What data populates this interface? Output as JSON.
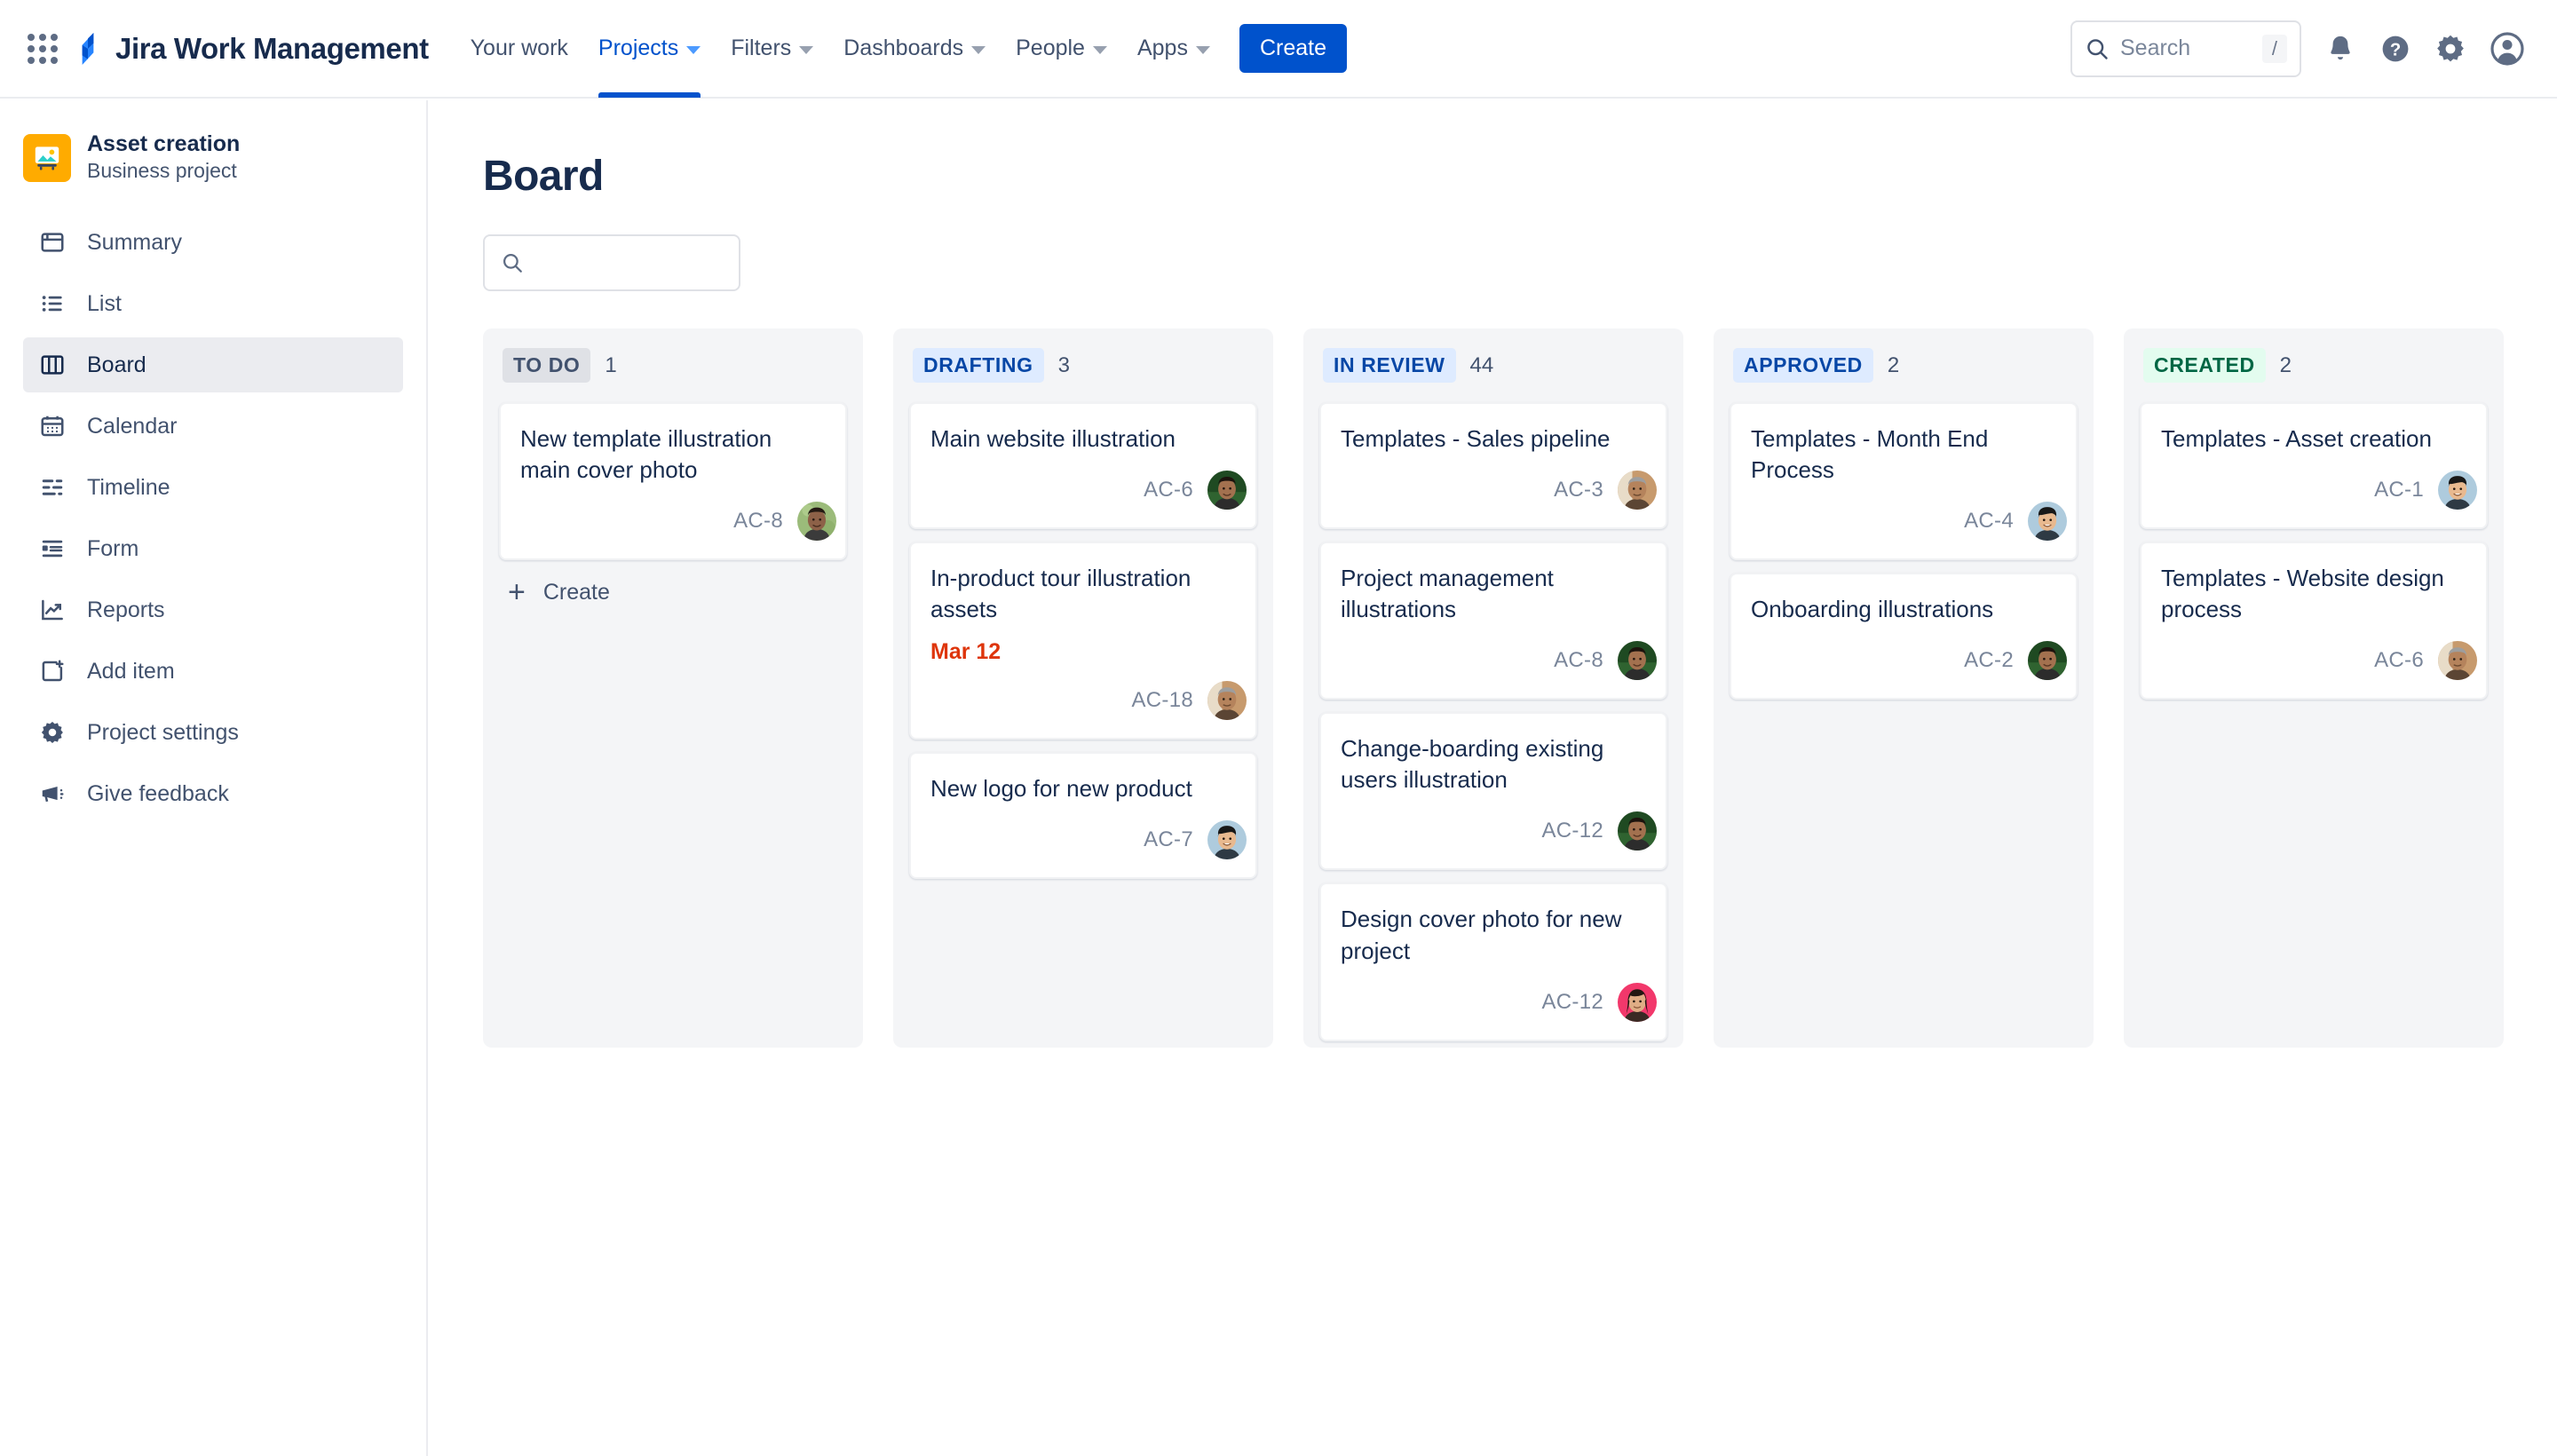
{
  "topnav": {
    "app_switcher_icon": "grid-apps-icon",
    "logo_icon": "jira-logo-icon",
    "product_name": "Jira Work Management",
    "items": [
      {
        "label": "Your work",
        "has_caret": false,
        "active": false
      },
      {
        "label": "Projects",
        "has_caret": true,
        "active": true
      },
      {
        "label": "Filters",
        "has_caret": true,
        "active": false
      },
      {
        "label": "Dashboards",
        "has_caret": true,
        "active": false
      },
      {
        "label": "People",
        "has_caret": true,
        "active": false
      },
      {
        "label": "Apps",
        "has_caret": true,
        "active": false
      }
    ],
    "create_label": "Create",
    "search": {
      "icon": "search-icon",
      "placeholder": "Search",
      "value": "",
      "shortcut_badge": "/"
    },
    "right_icons": [
      {
        "name": "notifications-bell-icon"
      },
      {
        "name": "help-question-icon"
      },
      {
        "name": "settings-gear-icon"
      },
      {
        "name": "user-account-avatar-icon"
      }
    ]
  },
  "sidebar": {
    "project": {
      "avatar_icon": "project-image-icon",
      "avatar_color": "#FFAB00",
      "name": "Asset creation",
      "type": "Business project"
    },
    "items": [
      {
        "label": "Summary",
        "icon": "summary-window-icon",
        "selected": false
      },
      {
        "label": "List",
        "icon": "list-bullets-icon",
        "selected": false
      },
      {
        "label": "Board",
        "icon": "board-columns-icon",
        "selected": true
      },
      {
        "label": "Calendar",
        "icon": "calendar-icon",
        "selected": false
      },
      {
        "label": "Timeline",
        "icon": "timeline-icon",
        "selected": false
      },
      {
        "label": "Form",
        "icon": "form-icon",
        "selected": false
      },
      {
        "label": "Reports",
        "icon": "reports-chart-icon",
        "selected": false
      },
      {
        "label": "Add item",
        "icon": "add-item-plus-icon",
        "selected": false
      },
      {
        "label": "Project settings",
        "icon": "settings-gear-icon",
        "selected": false
      },
      {
        "label": "Give feedback",
        "icon": "megaphone-icon",
        "selected": false
      }
    ]
  },
  "main": {
    "page_title": "Board",
    "board_search": {
      "icon": "search-icon",
      "placeholder": "",
      "value": ""
    },
    "create_card_label": "Create",
    "columns": [
      {
        "name": "TO DO",
        "chip_style": "todo",
        "chip_bg": "#DFE1E6",
        "chip_fg": "#42526E",
        "count": "1",
        "show_create": true,
        "cards": [
          {
            "title": "New template illustration main cover photo",
            "due": null,
            "key": "AC-8",
            "avatar": "avatar-man-green-bg"
          }
        ]
      },
      {
        "name": "DRAFTING",
        "chip_style": "blue",
        "chip_bg": "#DEEBFF",
        "chip_fg": "#0747A6",
        "count": "3",
        "show_create": false,
        "cards": [
          {
            "title": "Main website illustration",
            "due": null,
            "key": "AC-6",
            "avatar": "avatar-man-dark-green-bg"
          },
          {
            "title": "In-product tour illustration assets",
            "due": "Mar 12",
            "key": "AC-18",
            "avatar": "avatar-older-man-tan-bg"
          },
          {
            "title": "New logo for new product",
            "due": null,
            "key": "AC-7",
            "avatar": "avatar-child-blue-bg"
          }
        ]
      },
      {
        "name": "IN REVIEW",
        "chip_style": "blue",
        "chip_bg": "#DEEBFF",
        "chip_fg": "#0747A6",
        "count": "44",
        "show_create": false,
        "cards": [
          {
            "title": "Templates - Sales pipeline",
            "due": null,
            "key": "AC-3",
            "avatar": "avatar-older-man-tan-bg"
          },
          {
            "title": "Project management illustrations",
            "due": null,
            "key": "AC-8",
            "avatar": "avatar-man-dark-green-bg"
          },
          {
            "title": "Change-boarding existing users illustration",
            "due": null,
            "key": "AC-12",
            "avatar": "avatar-man-dark-green-bg"
          },
          {
            "title": "Design cover photo for new project",
            "due": null,
            "key": "AC-12",
            "avatar": "avatar-woman-pink-bg"
          }
        ]
      },
      {
        "name": "APPROVED",
        "chip_style": "blue",
        "chip_bg": "#DEEBFF",
        "chip_fg": "#0747A6",
        "count": "2",
        "show_create": false,
        "cards": [
          {
            "title": "Templates - Month End Process",
            "due": null,
            "key": "AC-4",
            "avatar": "avatar-child-blue-bg"
          },
          {
            "title": "Onboarding illustrations",
            "due": null,
            "key": "AC-2",
            "avatar": "avatar-man-dark-green-bg"
          }
        ]
      },
      {
        "name": "CREATED",
        "chip_style": "green",
        "chip_bg": "#E3FCEF",
        "chip_fg": "#006644",
        "count": "2",
        "show_create": false,
        "cards": [
          {
            "title": "Templates - Asset creation",
            "due": null,
            "key": "AC-1",
            "avatar": "avatar-child-blue-bg"
          },
          {
            "title": "Templates - Website design process",
            "due": null,
            "key": "AC-6",
            "avatar": "avatar-older-man-tan-bg"
          }
        ]
      }
    ]
  },
  "colors": {
    "brand_blue": "#0052CC",
    "link_blue": "#0747A6",
    "text": "#172B4D",
    "subtle_text": "#7A869A",
    "column_bg": "#F4F5F7",
    "border": "#DFE1E6",
    "due_red": "#DE350B",
    "green": "#006644",
    "project_orange": "#FFAB00"
  }
}
